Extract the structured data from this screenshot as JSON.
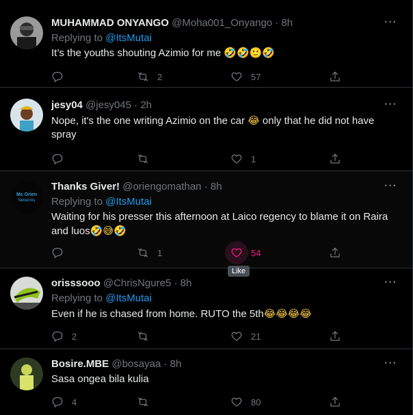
{
  "tweets": [
    {
      "name": "MUHAMMAD ONYANGO",
      "handle": "@Moha001_Onyango",
      "time": "· 8h",
      "reply_prefix": "Replying to",
      "reply_to": "@ItsMutai",
      "text": "It’s the youths shouting Azimio for me",
      "emoji": "🤣🤣🙂🤣",
      "text2": "",
      "reply_count": "",
      "retweet_count": "2",
      "like_count": "57"
    },
    {
      "name": "jesy04",
      "handle": "@jesy045",
      "time": "· 2h",
      "text": "Nope, it's the one writing Azimio on the car",
      "emoji": "😂",
      "text2": "only that he did not have",
      "text_line2": "spray",
      "reply_count": "",
      "retweet_count": "",
      "like_count": "1"
    },
    {
      "name": "Thanks Giver!",
      "handle": "@oriengomathan",
      "time": "· 8h",
      "reply_prefix": "Replying to",
      "reply_to": "@ItsMutai",
      "text": "Waiting for his presser this afternoon at Laico regency to blame it on Raira",
      "text_line2": "and luos",
      "emoji": "🤣😅🤣",
      "reply_count": "",
      "retweet_count": "1",
      "like_count": "54",
      "avatar_text": "Mc Orien Networks"
    },
    {
      "name": "orisssooo",
      "handle": "@ChrisNgure5",
      "time": "· 8h",
      "reply_prefix": "Replying to",
      "reply_to": "@ItsMutai",
      "text": "Even if he is chased from home. RUTO the 5th",
      "emoji": "😂😂😂😂",
      "reply_count": "2",
      "retweet_count": "",
      "like_count": "21"
    },
    {
      "name": "Bosire.MBE",
      "handle": "@bosayaa",
      "time": "· 8h",
      "text": "Sasa ongea bila kulia",
      "reply_count": "4",
      "retweet_count": "",
      "like_count": "80"
    }
  ],
  "tooltip": "Like",
  "more_glyph": "···",
  "colors": {
    "accent": "#1d9bf0",
    "like": "#f91880",
    "muted": "#71767b"
  }
}
